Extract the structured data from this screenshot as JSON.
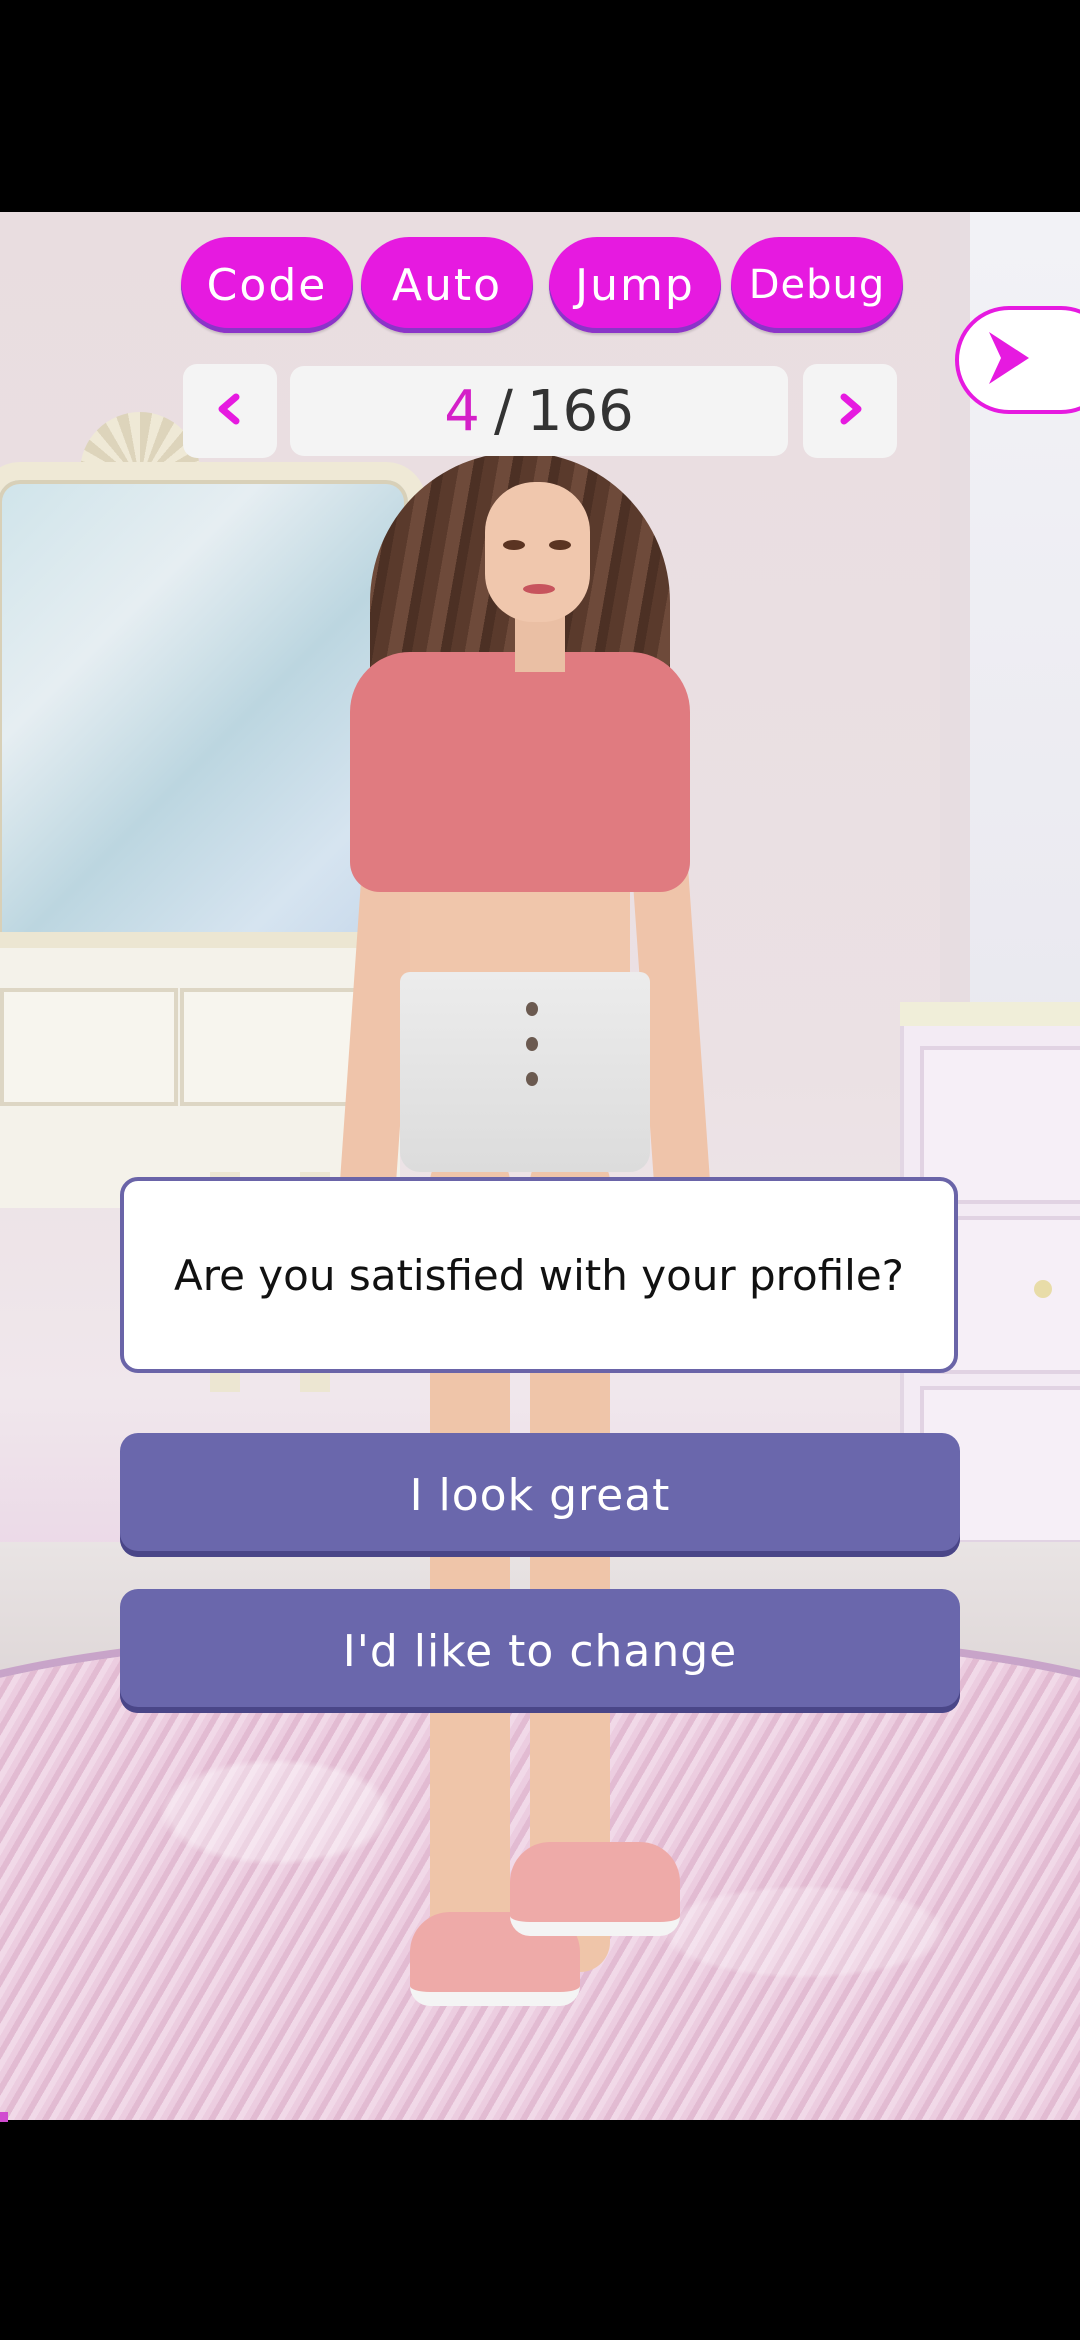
{
  "toolbar": {
    "code_label": "Code",
    "auto_label": "Auto",
    "jump_label": "Jump",
    "debug_label": "Debug"
  },
  "navigation": {
    "current": "4",
    "separator": "/",
    "total": "166",
    "prev_icon": "chevron-left-icon",
    "next_icon": "chevron-right-icon",
    "side_next_icon": "play-arrow-icon"
  },
  "dialog": {
    "question": "Are you satisfied with your profile?",
    "choices": [
      {
        "label": "I look great"
      },
      {
        "label": "I'd like to change"
      }
    ]
  },
  "colors": {
    "accent": "#e61ae0",
    "choice_bg": "#6a67ac",
    "question_border": "#6a64a8"
  }
}
